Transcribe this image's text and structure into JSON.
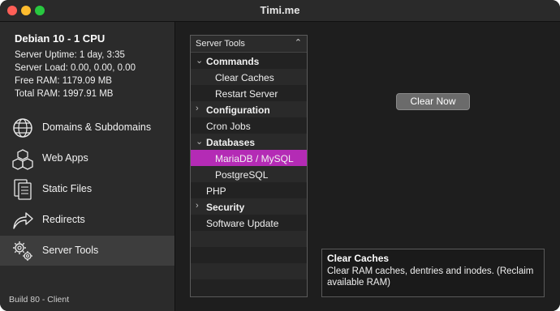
{
  "window": {
    "title": "Timi.me"
  },
  "sidebar": {
    "server_name": "Debian 10 - 1 CPU",
    "stats": [
      "Server Uptime: 1 day,  3:35",
      "Server Load: 0.00, 0.00, 0.00",
      "Free RAM: 1179.09 MB",
      "Total RAM: 1997.91 MB"
    ],
    "items": [
      {
        "label": "Domains & Subdomains",
        "icon": "globe-icon"
      },
      {
        "label": "Web Apps",
        "icon": "cubes-icon"
      },
      {
        "label": "Static Files",
        "icon": "documents-icon"
      },
      {
        "label": "Redirects",
        "icon": "redirect-arrow-icon"
      },
      {
        "label": "Server Tools",
        "icon": "gears-icon",
        "active": true
      }
    ],
    "build": "Build 80 - Client"
  },
  "outline": {
    "header": "Server Tools",
    "rows": [
      {
        "label": "Commands",
        "type": "group",
        "expanded": true
      },
      {
        "label": "Clear Caches",
        "type": "child"
      },
      {
        "label": "Restart Server",
        "type": "child"
      },
      {
        "label": "Configuration",
        "type": "group",
        "expanded": false
      },
      {
        "label": "Cron Jobs",
        "type": "item"
      },
      {
        "label": "Databases",
        "type": "group",
        "expanded": true
      },
      {
        "label": "MariaDB / MySQL",
        "type": "child",
        "selected": true
      },
      {
        "label": "PostgreSQL",
        "type": "child"
      },
      {
        "label": "PHP",
        "type": "item"
      },
      {
        "label": "Security",
        "type": "group",
        "expanded": false
      },
      {
        "label": "Software Update",
        "type": "item"
      }
    ]
  },
  "action": {
    "clear_now_label": "Clear Now"
  },
  "description": {
    "title": "Clear Caches",
    "text": "Clear RAM caches, dentries and inodes. (Reclaim available RAM)"
  },
  "colors": {
    "selection": "#b42bb5",
    "background": "#1e1e1e",
    "sidebar": "#2b2b2b"
  }
}
